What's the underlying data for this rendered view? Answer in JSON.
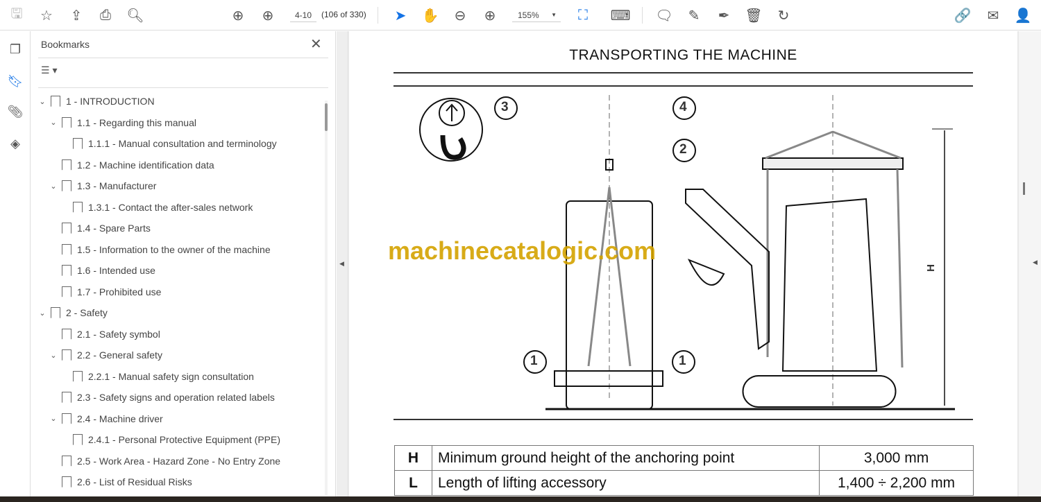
{
  "toolbar": {
    "page_value": "4-10",
    "page_count": "(106 of 330)",
    "zoom": "155%"
  },
  "bookmarks": {
    "title": "Bookmarks",
    "items": [
      {
        "label": "1  -  INTRODUCTION",
        "level": 0,
        "expanded": true
      },
      {
        "label": "1.1 - Regarding this manual",
        "level": 1,
        "expanded": true
      },
      {
        "label": "1.1.1 - Manual consultation and terminology",
        "level": 2
      },
      {
        "label": "1.2 - Machine identification data",
        "level": 1
      },
      {
        "label": "1.3 - Manufacturer",
        "level": 1,
        "expanded": true
      },
      {
        "label": "1.3.1 - Contact the after-sales network",
        "level": 2
      },
      {
        "label": "1.4 - Spare Parts",
        "level": 1
      },
      {
        "label": "1.5 - Information to the owner of the machine",
        "level": 1
      },
      {
        "label": "1.6 - Intended use",
        "level": 1
      },
      {
        "label": "1.7 - Prohibited use",
        "level": 1
      },
      {
        "label": "2  -  Safety",
        "level": 0,
        "expanded": true
      },
      {
        "label": "2.1 - Safety symbol",
        "level": 1
      },
      {
        "label": "2.2 - General safety",
        "level": 1,
        "expanded": true
      },
      {
        "label": "2.2.1 - Manual safety sign consultation",
        "level": 2
      },
      {
        "label": "2.3 - Safety signs and operation related labels",
        "level": 1
      },
      {
        "label": "2.4 - Machine driver",
        "level": 1,
        "expanded": true
      },
      {
        "label": "2.4.1 - Personal Protective Equipment (PPE)",
        "level": 2
      },
      {
        "label": "2.5 - Work Area - Hazard Zone - No Entry Zone",
        "level": 1
      },
      {
        "label": "2.6 - List of Residual Risks",
        "level": 1
      }
    ]
  },
  "document": {
    "title": "TRANSPORTING THE MACHINE",
    "watermark": "machinecatalogic.com",
    "callouts": [
      "1",
      "1",
      "2",
      "3",
      "4"
    ],
    "dimension_label": "H",
    "table": [
      {
        "key": "H",
        "desc": "Minimum ground height of the anchoring point",
        "value": "3,000 mm"
      },
      {
        "key": "L",
        "desc": "Length of lifting accessory",
        "value": "1,400 ÷ 2,200 mm"
      }
    ]
  }
}
